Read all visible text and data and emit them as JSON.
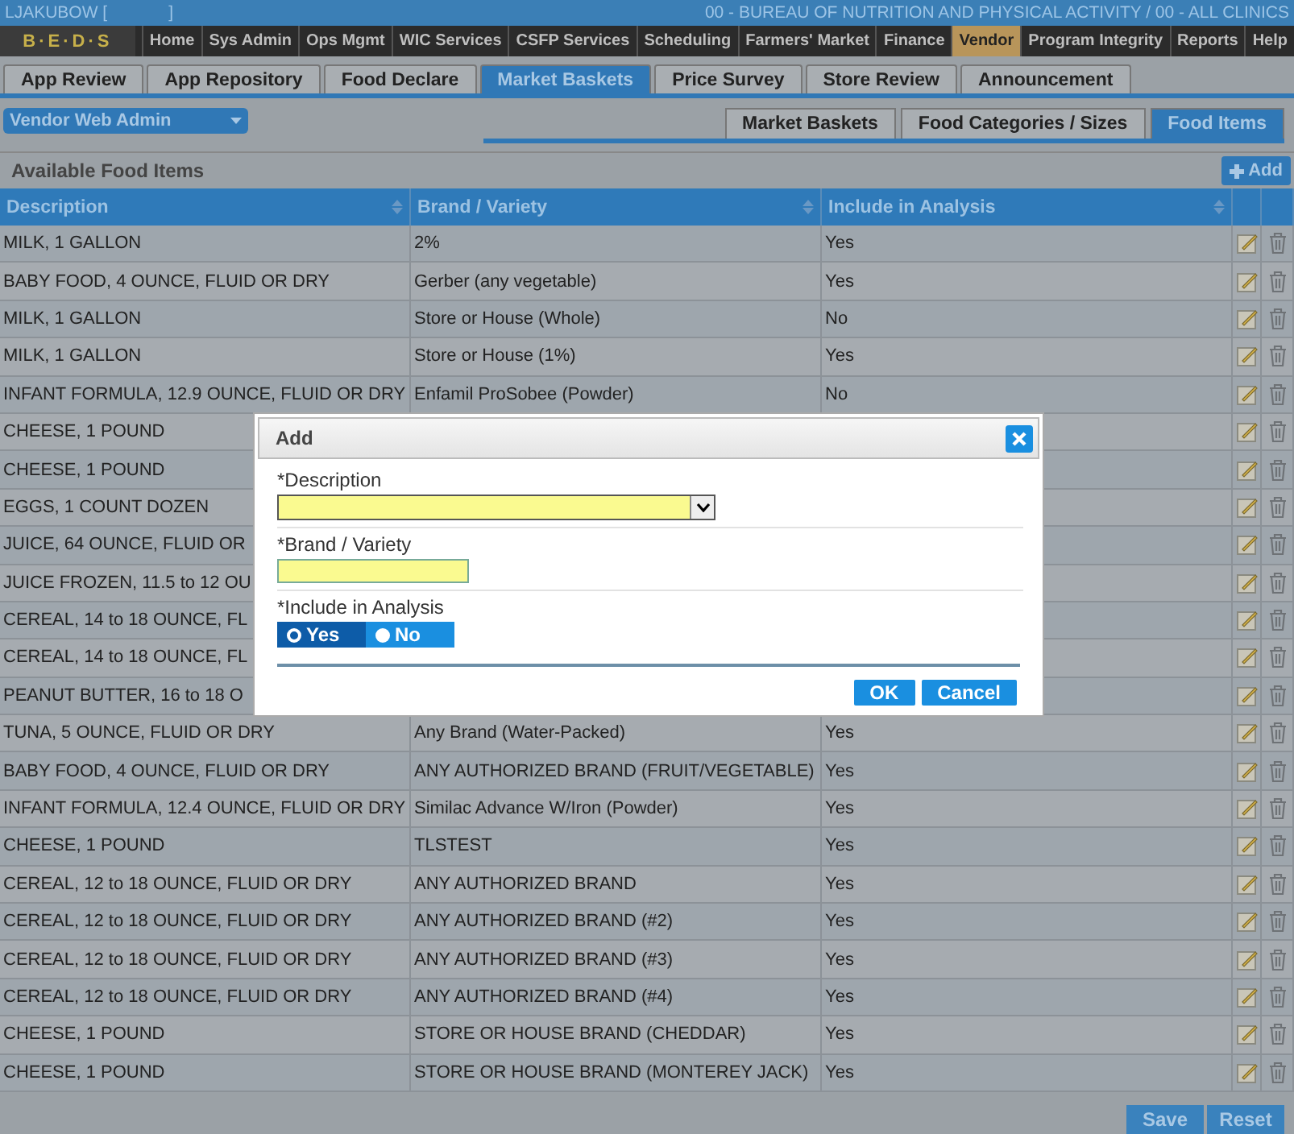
{
  "top_bar": {
    "user": "LJAKUBOW [",
    "user_end": "]",
    "agency": "00 - BUREAU OF NUTRITION AND PHYSICAL ACTIVITY / 00 - ALL CLINICS"
  },
  "logo": {
    "text": "B·E·D·S"
  },
  "nav": [
    {
      "label": "Home",
      "selected": false
    },
    {
      "label": "Sys Admin",
      "selected": false
    },
    {
      "label": "Ops Mgmt",
      "selected": false
    },
    {
      "label": "WIC Services",
      "selected": false
    },
    {
      "label": "CSFP Services",
      "selected": false
    },
    {
      "label": "Scheduling",
      "selected": false
    },
    {
      "label": "Farmers' Market",
      "selected": false
    },
    {
      "label": "Finance",
      "selected": false
    },
    {
      "label": "Vendor",
      "selected": true
    },
    {
      "label": "Program Integrity",
      "selected": false
    },
    {
      "label": "Reports",
      "selected": false
    },
    {
      "label": "Help",
      "selected": false
    }
  ],
  "tabs": [
    {
      "label": "App Review",
      "selected": false
    },
    {
      "label": "App Repository",
      "selected": false
    },
    {
      "label": "Food Declare",
      "selected": false
    },
    {
      "label": "Market Baskets",
      "selected": true
    },
    {
      "label": "Price Survey",
      "selected": false
    },
    {
      "label": "Store Review",
      "selected": false
    },
    {
      "label": "Announcement",
      "selected": false
    }
  ],
  "role_select": {
    "value": "Vendor Web Admin"
  },
  "sub_tabs": [
    {
      "label": "Market Baskets",
      "selected": false
    },
    {
      "label": "Food Categories / Sizes",
      "selected": false
    },
    {
      "label": "Food Items",
      "selected": true
    }
  ],
  "panel": {
    "title": "Available Food Items",
    "add_button": "Add"
  },
  "table": {
    "columns": [
      "Description",
      "Brand / Variety",
      "Include in Analysis"
    ],
    "rows": [
      {
        "description": "MILK, 1 GALLON",
        "brand": "2%",
        "include": "Yes"
      },
      {
        "description": "BABY FOOD, 4 OUNCE, FLUID OR DRY",
        "brand": "Gerber (any vegetable)",
        "include": "Yes"
      },
      {
        "description": "MILK, 1 GALLON",
        "brand": "Store or House (Whole)",
        "include": "No"
      },
      {
        "description": "MILK, 1 GALLON",
        "brand": "Store or House (1%)",
        "include": "Yes"
      },
      {
        "description": "INFANT FORMULA, 12.9 OUNCE, FLUID OR DRY",
        "brand": "Enfamil ProSobee (Powder)",
        "include": "No"
      },
      {
        "description": "CHEESE, 1 POUND"
      },
      {
        "description": "CHEESE, 1 POUND"
      },
      {
        "description": "EGGS, 1 COUNT DOZEN"
      },
      {
        "description": "JUICE, 64 OUNCE, FLUID OR"
      },
      {
        "description": "JUICE FROZEN, 11.5 to 12 OU"
      },
      {
        "description": "CEREAL, 14 to 18 OUNCE, FL"
      },
      {
        "description": "CEREAL, 14 to 18 OUNCE, FL"
      },
      {
        "description": "PEANUT BUTTER, 16 to 18 O"
      },
      {
        "description": "TUNA, 5 OUNCE, FLUID OR DRY",
        "brand": "Any Brand (Water-Packed)",
        "include": "Yes"
      },
      {
        "description": "BABY FOOD, 4 OUNCE, FLUID OR DRY",
        "brand": "ANY AUTHORIZED BRAND (FRUIT/VEGETABLE)",
        "include": "Yes"
      },
      {
        "description": "INFANT FORMULA, 12.4 OUNCE, FLUID OR DRY",
        "brand": "Similac Advance W/Iron (Powder)",
        "include": "Yes"
      },
      {
        "description": "CHEESE, 1 POUND",
        "brand": "TLSTEST",
        "include": "Yes"
      },
      {
        "description": "CEREAL, 12 to 18 OUNCE, FLUID OR DRY",
        "brand": "ANY AUTHORIZED BRAND",
        "include": "Yes"
      },
      {
        "description": "CEREAL, 12 to 18 OUNCE, FLUID OR DRY",
        "brand": "ANY AUTHORIZED BRAND (#2)",
        "include": "Yes"
      },
      {
        "description": "CEREAL, 12 to 18 OUNCE, FLUID OR DRY",
        "brand": "ANY AUTHORIZED BRAND (#3)",
        "include": "Yes"
      },
      {
        "description": "CEREAL, 12 to 18 OUNCE, FLUID OR DRY",
        "brand": "ANY AUTHORIZED BRAND (#4)",
        "include": "Yes"
      },
      {
        "description": "CHEESE, 1 POUND",
        "brand": "STORE OR HOUSE BRAND (CHEDDAR)",
        "include": "Yes"
      },
      {
        "description": "CHEESE, 1 POUND",
        "brand": "STORE OR HOUSE BRAND (MONTEREY JACK)",
        "include": "Yes"
      }
    ]
  },
  "footer_buttons": [
    "Save",
    "Reset"
  ],
  "dialog": {
    "title": "Add",
    "description_label": "*Description",
    "brand_label": "*Brand / Variety",
    "include_label": "*Include in Analysis",
    "include_options": [
      {
        "label": "Yes",
        "selected": true
      },
      {
        "label": "No",
        "selected": false
      }
    ],
    "buttons": [
      "OK",
      "Cancel"
    ]
  }
}
